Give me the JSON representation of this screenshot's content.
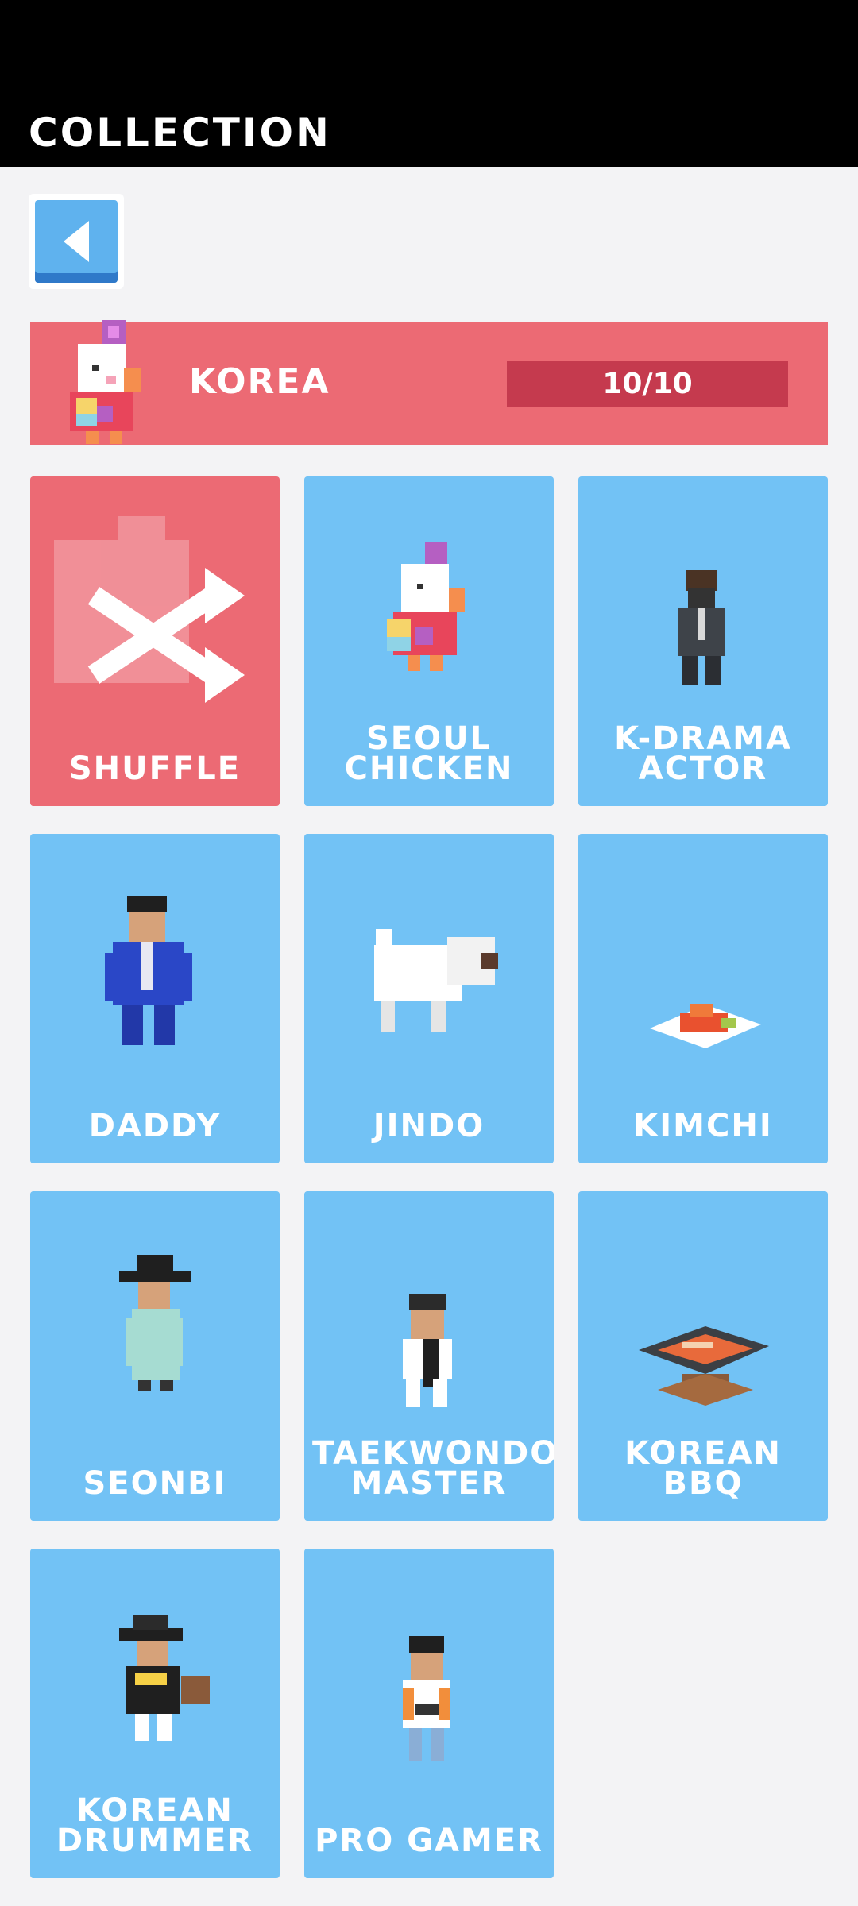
{
  "topbar": {
    "title": "COLLECTION"
  },
  "header": {
    "name": "KOREA",
    "progress": "10/10",
    "progress_fraction": 1.0
  },
  "cards": [
    {
      "label": "SHUFFLE",
      "icon": "shuffle-icon"
    },
    {
      "label": "SEOUL\nCHICKEN",
      "icon": "seoul-chicken-icon"
    },
    {
      "label": "K-DRAMA\nACTOR",
      "icon": "k-drama-actor-icon"
    },
    {
      "label": "DADDY",
      "icon": "daddy-icon"
    },
    {
      "label": "JINDO",
      "icon": "jindo-icon"
    },
    {
      "label": "KIMCHI",
      "icon": "kimchi-icon"
    },
    {
      "label": "SEONBI",
      "icon": "seonbi-icon"
    },
    {
      "label": "TAEKWONDO\nMASTER",
      "icon": "taekwondo-master-icon"
    },
    {
      "label": "KOREAN\nBBQ",
      "icon": "korean-bbq-icon"
    },
    {
      "label": "KOREAN\nDRUMMER",
      "icon": "korean-drummer-icon"
    },
    {
      "label": "PRO GAMER",
      "icon": "pro-gamer-icon"
    }
  ],
  "colors": {
    "card": "#72c2f5",
    "accent": "#ec6a74",
    "progress": "#c53a4e",
    "background": "#f3f3f5"
  }
}
